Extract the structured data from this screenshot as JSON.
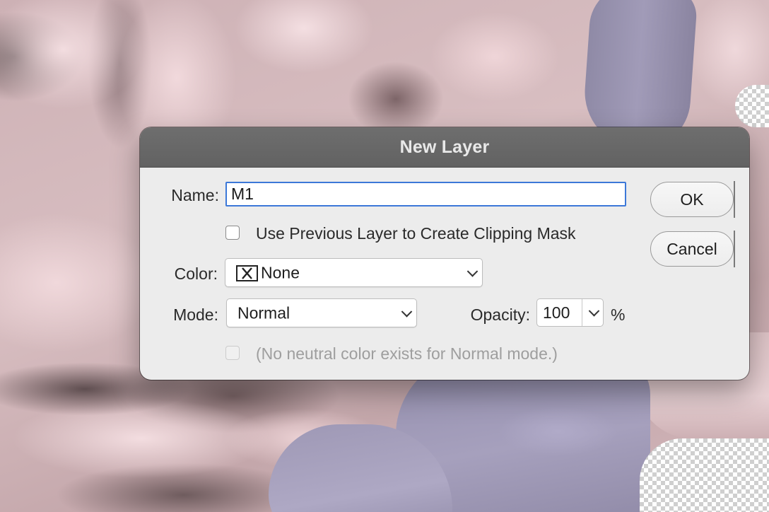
{
  "dialog": {
    "title": "New Layer",
    "name_label": "Name:",
    "name_value": "M1",
    "clipping_mask_label": "Use Previous Layer to Create Clipping Mask",
    "clipping_mask_checked": false,
    "color_label": "Color:",
    "color_value": "None",
    "color_icon": "x-box-icon",
    "mode_label": "Mode:",
    "mode_value": "Normal",
    "opacity_label": "Opacity:",
    "opacity_value": "100",
    "opacity_unit": "%",
    "neutral_label": "(No neutral color exists for Normal mode.)",
    "neutral_checked": false,
    "neutral_enabled": false,
    "ok_label": "OK",
    "cancel_label": "Cancel"
  },
  "colors": {
    "titlebar": "#666666",
    "dialog_bg": "#ececec",
    "focus_ring": "#3c78d8",
    "canvas_pink": "#d6b8bc",
    "canvas_purple": "#9d97b4"
  }
}
